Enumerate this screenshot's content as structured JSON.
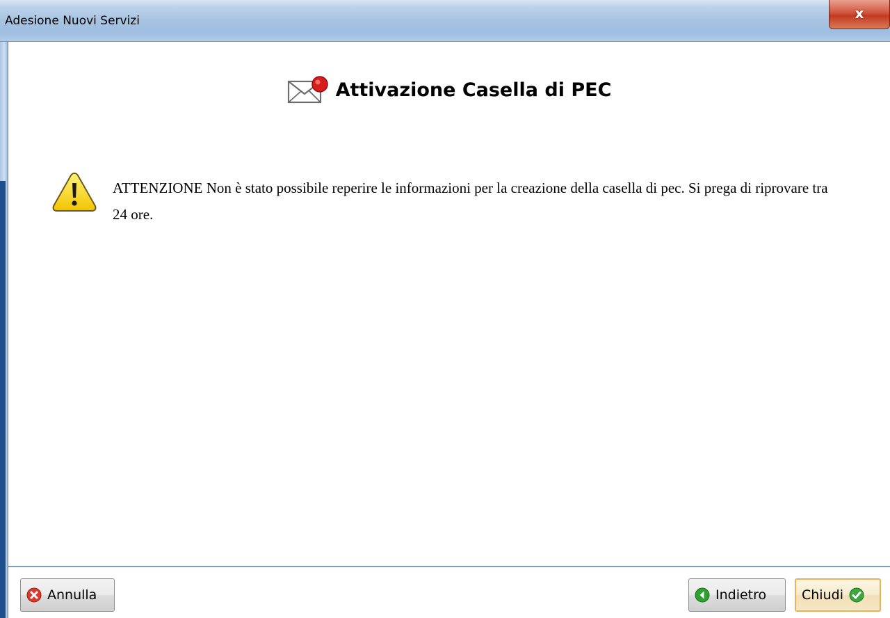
{
  "window": {
    "title": "Adesione Nuovi Servizi",
    "close_label": "x"
  },
  "content": {
    "heading": "Attivazione Casella di PEC",
    "message": "ATTENZIONE Non è stato possibile reperire le informazioni per la creazione della casella di pec. Si prega di riprovare tra 24 ore."
  },
  "footer": {
    "cancel_label": "Annulla",
    "back_label": "Indietro",
    "close_label": "Chiudi"
  },
  "icons": {
    "heading": "pec-envelope-icon",
    "warning": "warning-icon",
    "cancel": "cancel-icon",
    "back": "back-arrow-icon",
    "close": "check-icon"
  },
  "colors": {
    "titlebar": "#a9c4e2",
    "close_button": "#c23a22",
    "warning": "#f5d000",
    "cancel_icon": "#d93a2b",
    "back_icon": "#2fa12f",
    "check_icon": "#3aa83a",
    "default_button_border": "#e6b35a"
  }
}
